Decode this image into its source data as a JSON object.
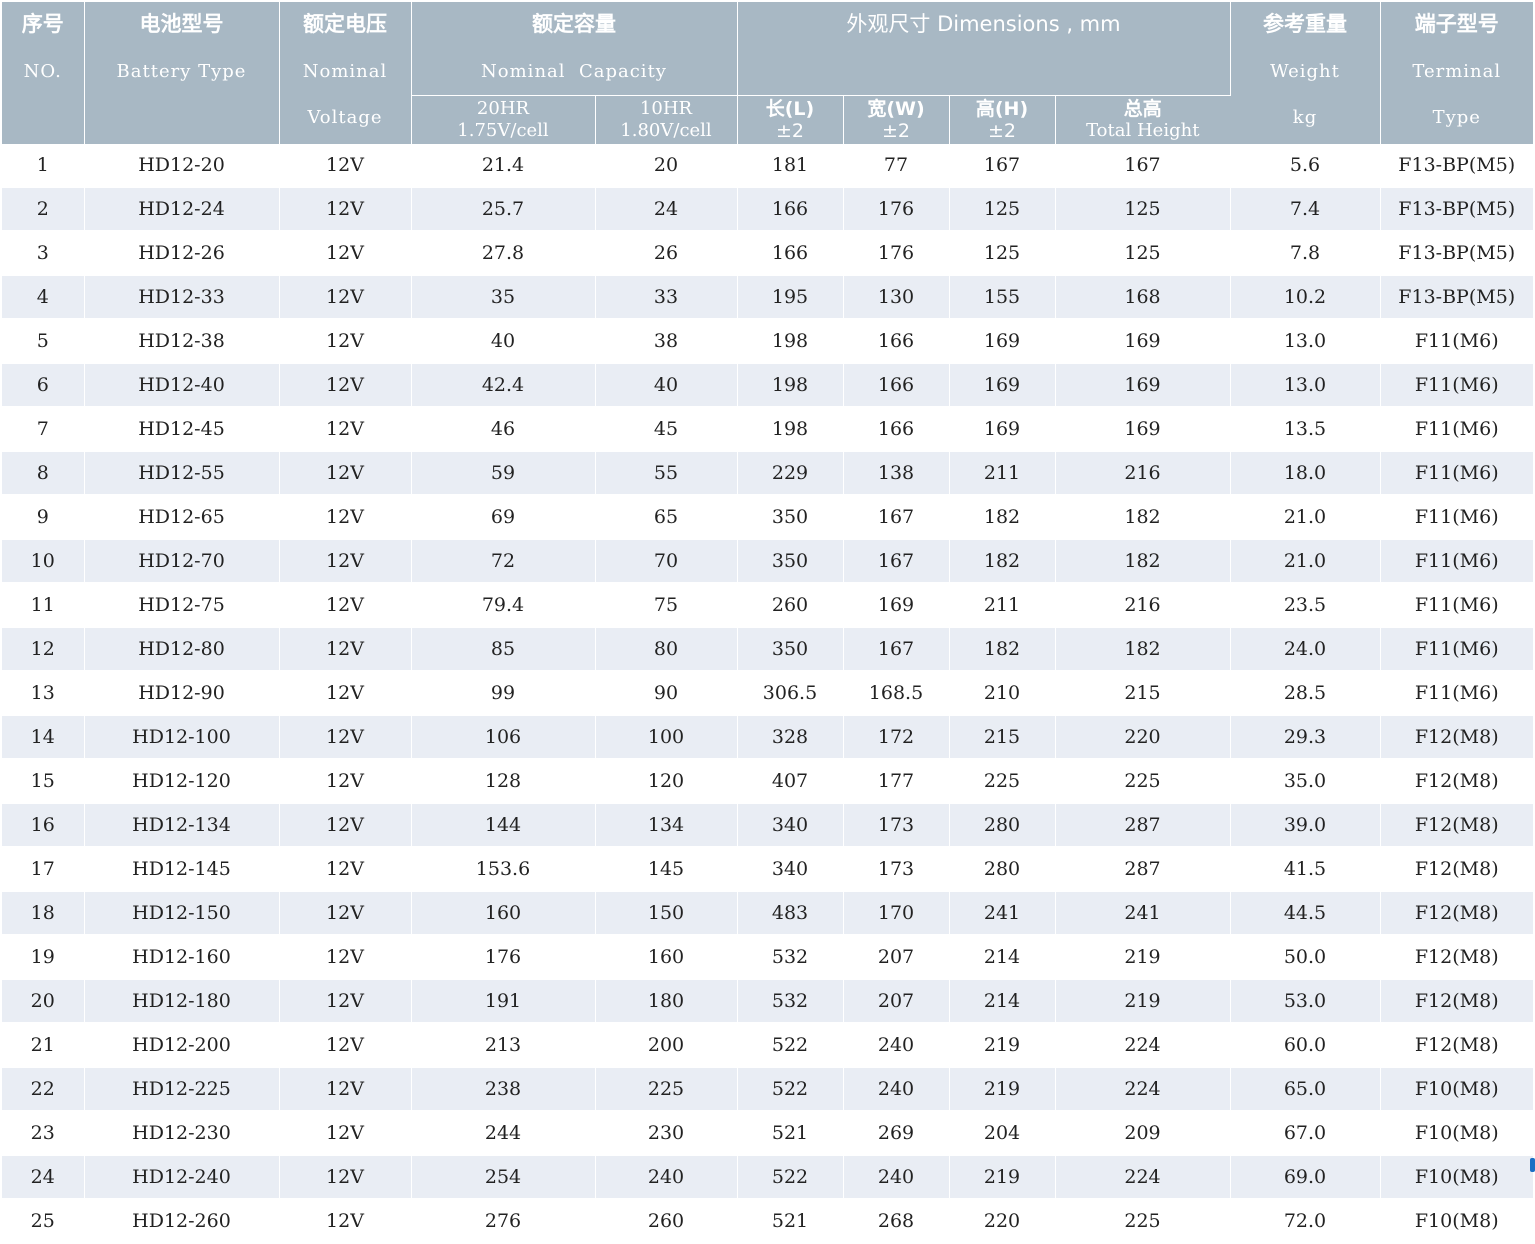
{
  "headers": {
    "no": {
      "zh": "序号",
      "en": "NO."
    },
    "type": {
      "zh": "电池型号",
      "en": "Battery Type"
    },
    "voltage": {
      "zh": "额定电压",
      "en1": "Nominal",
      "en2": "Voltage"
    },
    "capacity": {
      "zh": "额定容量",
      "en": "Nominal  Capacity",
      "sub20": {
        "l1": "20HR",
        "l2": "1.75V/cell"
      },
      "sub10": {
        "l1": "10HR",
        "l2": "1.80V/cell"
      }
    },
    "dimensions": {
      "title": "外观尺寸 Dimensions , mm",
      "length": {
        "l1": "长(L)",
        "l2": "±2"
      },
      "width": {
        "l1": "宽(W)",
        "l2": "±2"
      },
      "height": {
        "l1": "高(H)",
        "l2": "±2"
      },
      "total": {
        "l1": "总高",
        "l2": "Total Height"
      }
    },
    "weight": {
      "zh": "参考重量",
      "en1": "Weight",
      "en2": "kg"
    },
    "terminal": {
      "zh": "端子型号",
      "en1": "Terminal",
      "en2": "Type"
    }
  },
  "rows": [
    [
      "1",
      "HD12-20",
      "12V",
      "21.4",
      "20",
      "181",
      "77",
      "167",
      "167",
      "5.6",
      "F13-BP(M5)"
    ],
    [
      "2",
      "HD12-24",
      "12V",
      "25.7",
      "24",
      "166",
      "176",
      "125",
      "125",
      "7.4",
      "F13-BP(M5)"
    ],
    [
      "3",
      "HD12-26",
      "12V",
      "27.8",
      "26",
      "166",
      "176",
      "125",
      "125",
      "7.8",
      "F13-BP(M5)"
    ],
    [
      "4",
      "HD12-33",
      "12V",
      "35",
      "33",
      "195",
      "130",
      "155",
      "168",
      "10.2",
      "F13-BP(M5)"
    ],
    [
      "5",
      "HD12-38",
      "12V",
      "40",
      "38",
      "198",
      "166",
      "169",
      "169",
      "13.0",
      "F11(M6)"
    ],
    [
      "6",
      "HD12-40",
      "12V",
      "42.4",
      "40",
      "198",
      "166",
      "169",
      "169",
      "13.0",
      "F11(M6)"
    ],
    [
      "7",
      "HD12-45",
      "12V",
      "46",
      "45",
      "198",
      "166",
      "169",
      "169",
      "13.5",
      "F11(M6)"
    ],
    [
      "8",
      "HD12-55",
      "12V",
      "59",
      "55",
      "229",
      "138",
      "211",
      "216",
      "18.0",
      "F11(M6)"
    ],
    [
      "9",
      "HD12-65",
      "12V",
      "69",
      "65",
      "350",
      "167",
      "182",
      "182",
      "21.0",
      "F11(M6)"
    ],
    [
      "10",
      "HD12-70",
      "12V",
      "72",
      "70",
      "350",
      "167",
      "182",
      "182",
      "21.0",
      "F11(M6)"
    ],
    [
      "11",
      "HD12-75",
      "12V",
      "79.4",
      "75",
      "260",
      "169",
      "211",
      "216",
      "23.5",
      "F11(M6)"
    ],
    [
      "12",
      "HD12-80",
      "12V",
      "85",
      "80",
      "350",
      "167",
      "182",
      "182",
      "24.0",
      "F11(M6)"
    ],
    [
      "13",
      "HD12-90",
      "12V",
      "99",
      "90",
      "306.5",
      "168.5",
      "210",
      "215",
      "28.5",
      "F11(M6)"
    ],
    [
      "14",
      "HD12-100",
      "12V",
      "106",
      "100",
      "328",
      "172",
      "215",
      "220",
      "29.3",
      "F12(M8)"
    ],
    [
      "15",
      "HD12-120",
      "12V",
      "128",
      "120",
      "407",
      "177",
      "225",
      "225",
      "35.0",
      "F12(M8)"
    ],
    [
      "16",
      "HD12-134",
      "12V",
      "144",
      "134",
      "340",
      "173",
      "280",
      "287",
      "39.0",
      "F12(M8)"
    ],
    [
      "17",
      "HD12-145",
      "12V",
      "153.6",
      "145",
      "340",
      "173",
      "280",
      "287",
      "41.5",
      "F12(M8)"
    ],
    [
      "18",
      "HD12-150",
      "12V",
      "160",
      "150",
      "483",
      "170",
      "241",
      "241",
      "44.5",
      "F12(M8)"
    ],
    [
      "19",
      "HD12-160",
      "12V",
      "176",
      "160",
      "532",
      "207",
      "214",
      "219",
      "50.0",
      "F12(M8)"
    ],
    [
      "20",
      "HD12-180",
      "12V",
      "191",
      "180",
      "532",
      "207",
      "214",
      "219",
      "53.0",
      "F12(M8)"
    ],
    [
      "21",
      "HD12-200",
      "12V",
      "213",
      "200",
      "522",
      "240",
      "219",
      "224",
      "60.0",
      "F12(M8)"
    ],
    [
      "22",
      "HD12-225",
      "12V",
      "238",
      "225",
      "522",
      "240",
      "219",
      "224",
      "65.0",
      "F10(M8)"
    ],
    [
      "23",
      "HD12-230",
      "12V",
      "244",
      "230",
      "521",
      "269",
      "204",
      "209",
      "67.0",
      "F10(M8)"
    ],
    [
      "24",
      "HD12-240",
      "12V",
      "254",
      "240",
      "522",
      "240",
      "219",
      "224",
      "69.0",
      "F10(M8)"
    ],
    [
      "25",
      "HD12-260",
      "12V",
      "276",
      "260",
      "521",
      "268",
      "220",
      "225",
      "72.0",
      "F10(M8)"
    ]
  ]
}
